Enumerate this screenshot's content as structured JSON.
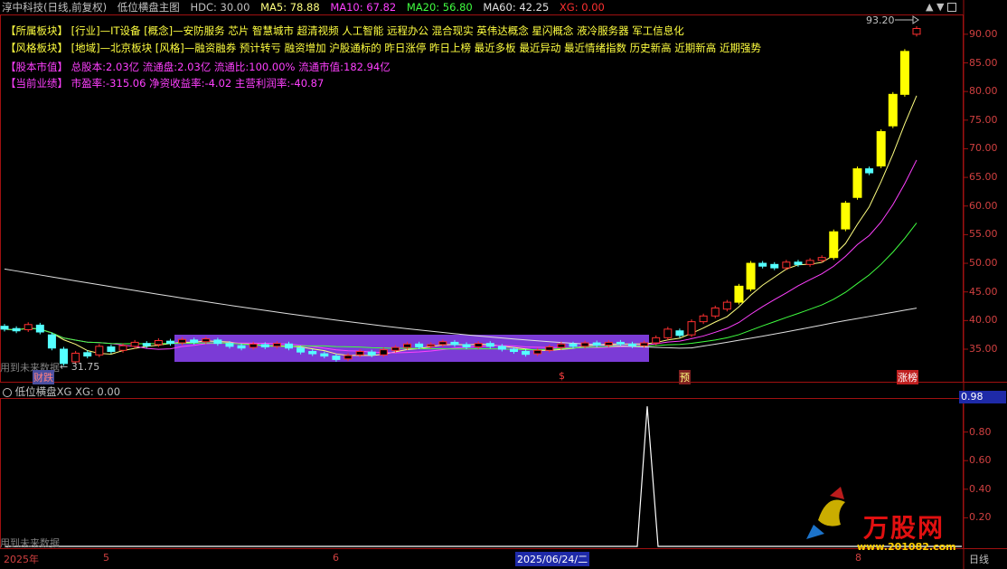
{
  "header": {
    "stock_name": "淳中科技(日线,前复权)",
    "indicator_name": "低位横盘主图",
    "hdc": "HDC: 30.00",
    "ma5": "MA5: 78.88",
    "ma10": "MA10: 67.82",
    "ma20": "MA20: 56.80",
    "ma60": "MA60: 42.25",
    "xg": "XG: 0.00",
    "high_label": "93.20"
  },
  "info": {
    "sector_label": "【所属板块】",
    "sector_text": "[行业]—IT设备 [概念]—安防服务 芯片 智慧城市 超清视频 人工智能 远程办公 混合现实 英伟达概念 星闪概念 液冷服务器 军工信息化",
    "style_label": "【风格板块】",
    "style_text": "[地域]—北京板块 [风格]—融资融券 预计转亏 融资增加 沪股通标的 昨日涨停 昨日上榜 最近多板 最近异动 最近情绪指数 历史新高 近期新高 近期强势",
    "cap_label": "【股本市值】",
    "cap_text": "总股本:2.03亿 流通盘:2.03亿 流通比:100.00% 流通市值:182.94亿",
    "perf_label": "【当前业绩】",
    "perf_text": "市盈率:-315.06 净资收益率:-4.02 主营利润率:-40.87"
  },
  "markers": {
    "low_price": "← 31.75",
    "future_data_1": "用到未来数据",
    "caidie": "财跌",
    "s_marker": "$",
    "yu_marker": "预",
    "zhangbang": "涨榜",
    "future_data_2": "用到未来数据"
  },
  "y_axis": [
    "90.00",
    "85.00",
    "80.00",
    "75.00",
    "70.00",
    "65.00",
    "60.00",
    "55.00",
    "50.00",
    "45.00",
    "40.00",
    "35.00"
  ],
  "sub_panel": {
    "title": "低位横盘XG  XG: 0.00",
    "value_box": "0.98",
    "y_axis": [
      "0.80",
      "0.60",
      "0.40",
      "0.20"
    ]
  },
  "x_axis": {
    "year": "2025年",
    "m5": "5",
    "m6": "6",
    "cursor_date": "2025/06/24/二",
    "m8": "8",
    "period": "日线"
  },
  "watermark": {
    "brand": "万股网",
    "url": "www.201082.com"
  },
  "colors": {
    "up": "#ff3030",
    "up_big": "#ffff00",
    "down": "#54ffff",
    "ma5": "#ffff80",
    "ma10": "#ff40ff",
    "ma20": "#40ff40",
    "ma60": "#e0e0e0",
    "box": "#8a3fe0",
    "axis": "#a01010"
  },
  "price_series": [
    {
      "o": 39.0,
      "c": 38.5
    },
    {
      "o": 38.6,
      "c": 38.2
    },
    {
      "o": 38.4,
      "c": 39.3
    },
    {
      "o": 39.2,
      "c": 38.0
    },
    {
      "o": 37.5,
      "c": 35.2
    },
    {
      "o": 35.0,
      "c": 32.5
    },
    {
      "o": 32.8,
      "c": 34.3
    },
    {
      "o": 34.4,
      "c": 33.8
    },
    {
      "o": 34.0,
      "c": 35.5
    },
    {
      "o": 35.4,
      "c": 34.6
    },
    {
      "o": 34.8,
      "c": 35.6
    },
    {
      "o": 35.5,
      "c": 36.2
    },
    {
      "o": 36.0,
      "c": 35.6
    },
    {
      "o": 35.8,
      "c": 36.5
    },
    {
      "o": 36.4,
      "c": 36.0
    },
    {
      "o": 36.1,
      "c": 36.7
    },
    {
      "o": 36.6,
      "c": 36.2
    },
    {
      "o": 36.3,
      "c": 36.8
    },
    {
      "o": 36.6,
      "c": 36.0
    },
    {
      "o": 36.0,
      "c": 35.5
    },
    {
      "o": 35.6,
      "c": 35.2
    },
    {
      "o": 35.3,
      "c": 35.9
    },
    {
      "o": 35.8,
      "c": 35.4
    },
    {
      "o": 35.5,
      "c": 36.0
    },
    {
      "o": 35.9,
      "c": 35.2
    },
    {
      "o": 35.2,
      "c": 34.5
    },
    {
      "o": 34.6,
      "c": 34.2
    },
    {
      "o": 34.2,
      "c": 33.8
    },
    {
      "o": 33.8,
      "c": 33.2
    },
    {
      "o": 33.3,
      "c": 33.9
    },
    {
      "o": 34.0,
      "c": 34.6
    },
    {
      "o": 34.5,
      "c": 34.0
    },
    {
      "o": 34.0,
      "c": 34.9
    },
    {
      "o": 34.8,
      "c": 35.3
    },
    {
      "o": 35.3,
      "c": 35.9
    },
    {
      "o": 35.9,
      "c": 35.4
    },
    {
      "o": 35.5,
      "c": 35.8
    },
    {
      "o": 35.8,
      "c": 36.3
    },
    {
      "o": 36.2,
      "c": 35.8
    },
    {
      "o": 35.8,
      "c": 35.4
    },
    {
      "o": 35.4,
      "c": 36.0
    },
    {
      "o": 36.0,
      "c": 35.5
    },
    {
      "o": 35.5,
      "c": 35.0
    },
    {
      "o": 35.0,
      "c": 34.6
    },
    {
      "o": 34.6,
      "c": 34.1
    },
    {
      "o": 34.2,
      "c": 34.8
    },
    {
      "o": 34.8,
      "c": 35.4
    },
    {
      "o": 35.3,
      "c": 35.9
    },
    {
      "o": 35.9,
      "c": 35.5
    },
    {
      "o": 35.5,
      "c": 36.1
    },
    {
      "o": 36.1,
      "c": 35.7
    },
    {
      "o": 35.7,
      "c": 36.2
    },
    {
      "o": 36.2,
      "c": 35.9
    },
    {
      "o": 35.9,
      "c": 35.6
    },
    {
      "o": 35.6,
      "c": 36.1
    },
    {
      "o": 36.1,
      "c": 37.0
    },
    {
      "o": 37.0,
      "c": 38.5
    },
    {
      "o": 38.2,
      "c": 37.4
    },
    {
      "o": 37.5,
      "c": 39.8
    },
    {
      "o": 39.8,
      "c": 40.8
    },
    {
      "o": 40.8,
      "c": 42.2
    },
    {
      "o": 42.0,
      "c": 43.2
    },
    {
      "o": 43.2,
      "c": 46.0
    },
    {
      "o": 45.5,
      "c": 50.0
    },
    {
      "o": 50.0,
      "c": 49.5
    },
    {
      "o": 49.8,
      "c": 49.2
    },
    {
      "o": 49.2,
      "c": 50.2
    },
    {
      "o": 50.2,
      "c": 49.8
    },
    {
      "o": 49.8,
      "c": 50.5
    },
    {
      "o": 50.5,
      "c": 51.0
    },
    {
      "o": 51.0,
      "c": 55.5
    },
    {
      "o": 56.0,
      "c": 60.5
    },
    {
      "o": 61.5,
      "c": 66.5
    },
    {
      "o": 66.5,
      "c": 65.8
    },
    {
      "o": 67.0,
      "c": 73.0
    },
    {
      "o": 74.0,
      "c": 79.5
    },
    {
      "o": 79.5,
      "c": 87.0
    },
    {
      "o": 90.0,
      "c": 91.0
    }
  ],
  "sub_signal": {
    "peak": 0.98
  }
}
